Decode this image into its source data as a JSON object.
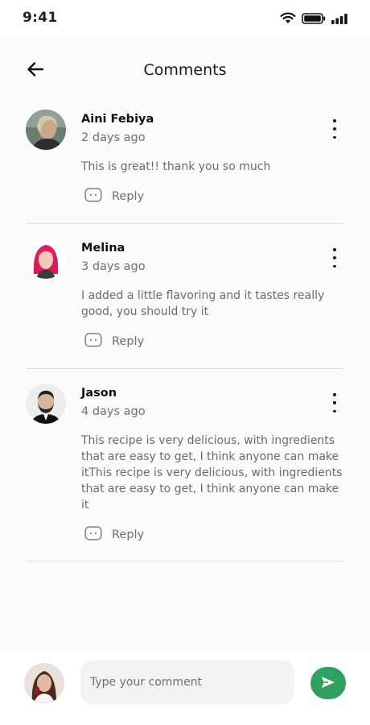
{
  "status_bar": {
    "time": "9:41",
    "icons": [
      "wifi-icon",
      "battery-icon",
      "signal-icon"
    ]
  },
  "header": {
    "back_icon": "arrow-left-icon",
    "title": "Comments"
  },
  "comments": [
    {
      "author": "Aini Febiya",
      "time": "2 days ago",
      "text": "This is great!! thank you so much",
      "reply_label": "Reply",
      "reply_icon": "chat-bubble-icon",
      "more_icon": "more-vertical-icon"
    },
    {
      "author": "Melina",
      "time": "3 days ago",
      "text": "I added a little flavoring and it tastes really good, you should try it",
      "reply_label": "Reply",
      "reply_icon": "chat-bubble-icon",
      "more_icon": "more-vertical-icon"
    },
    {
      "author": "Jason",
      "time": "4 days ago",
      "text": "This recipe is very delicious, with ingredients that are easy to get, I think anyone can make itThis recipe is very delicious, with ingredients that are easy to get, I think anyone can make it",
      "reply_label": "Reply",
      "reply_icon": "chat-bubble-icon",
      "more_icon": "more-vertical-icon"
    }
  ],
  "composer": {
    "placeholder": "Type your comment",
    "value": "",
    "send_icon": "send-icon"
  },
  "colors": {
    "accent": "#2ea05f",
    "background": "#fbfbfb",
    "muted_text": "#6b6b6b",
    "divider": "#e0e0e0"
  }
}
